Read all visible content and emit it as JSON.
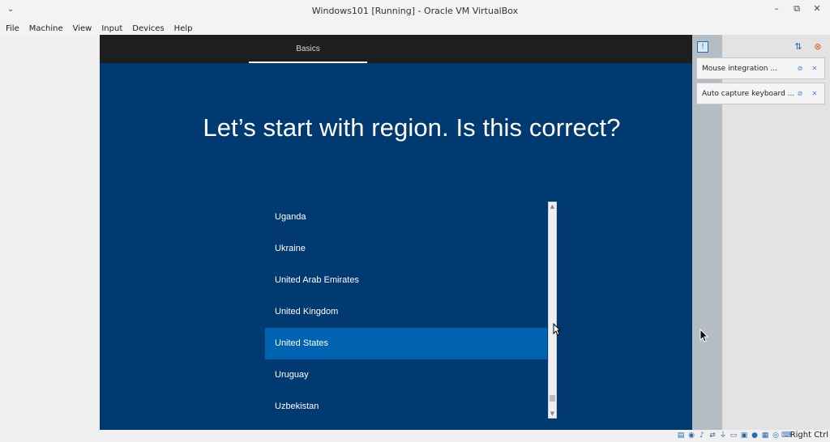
{
  "window": {
    "title": "Windows101 [Running] - Oracle VM VirtualBox",
    "menu_icon": "chevron-down-icon",
    "controls": {
      "minimize": "–",
      "restore": "⧉",
      "close": "✕"
    }
  },
  "menu": [
    "File",
    "Machine",
    "View",
    "Input",
    "Devices",
    "Help"
  ],
  "guest": {
    "tab_label": "Basics",
    "heading": "Let’s start with region. Is this correct?",
    "regions": [
      "Uganda",
      "Ukraine",
      "United Arab Emirates",
      "United Kingdom",
      "United States",
      "Uruguay",
      "Uzbekistan"
    ],
    "selected_region": "United States",
    "colors": {
      "background": "#003a70",
      "selected": "#0063b1",
      "topbar": "#1e1e1e"
    }
  },
  "notifications": [
    {
      "text": "Mouse integration ..."
    },
    {
      "text": "Auto capture keyboard ..."
    }
  ],
  "statusbar": {
    "host_key": "Right Ctrl",
    "icons": [
      "hard-disk-icon",
      "optical-drive-icon",
      "audio-icon",
      "network-icon",
      "usb-icon",
      "shared-folder-icon",
      "display-icon",
      "video-capture-icon",
      "cpu-icon",
      "mouse-integration-icon",
      "keyboard-icon"
    ]
  }
}
